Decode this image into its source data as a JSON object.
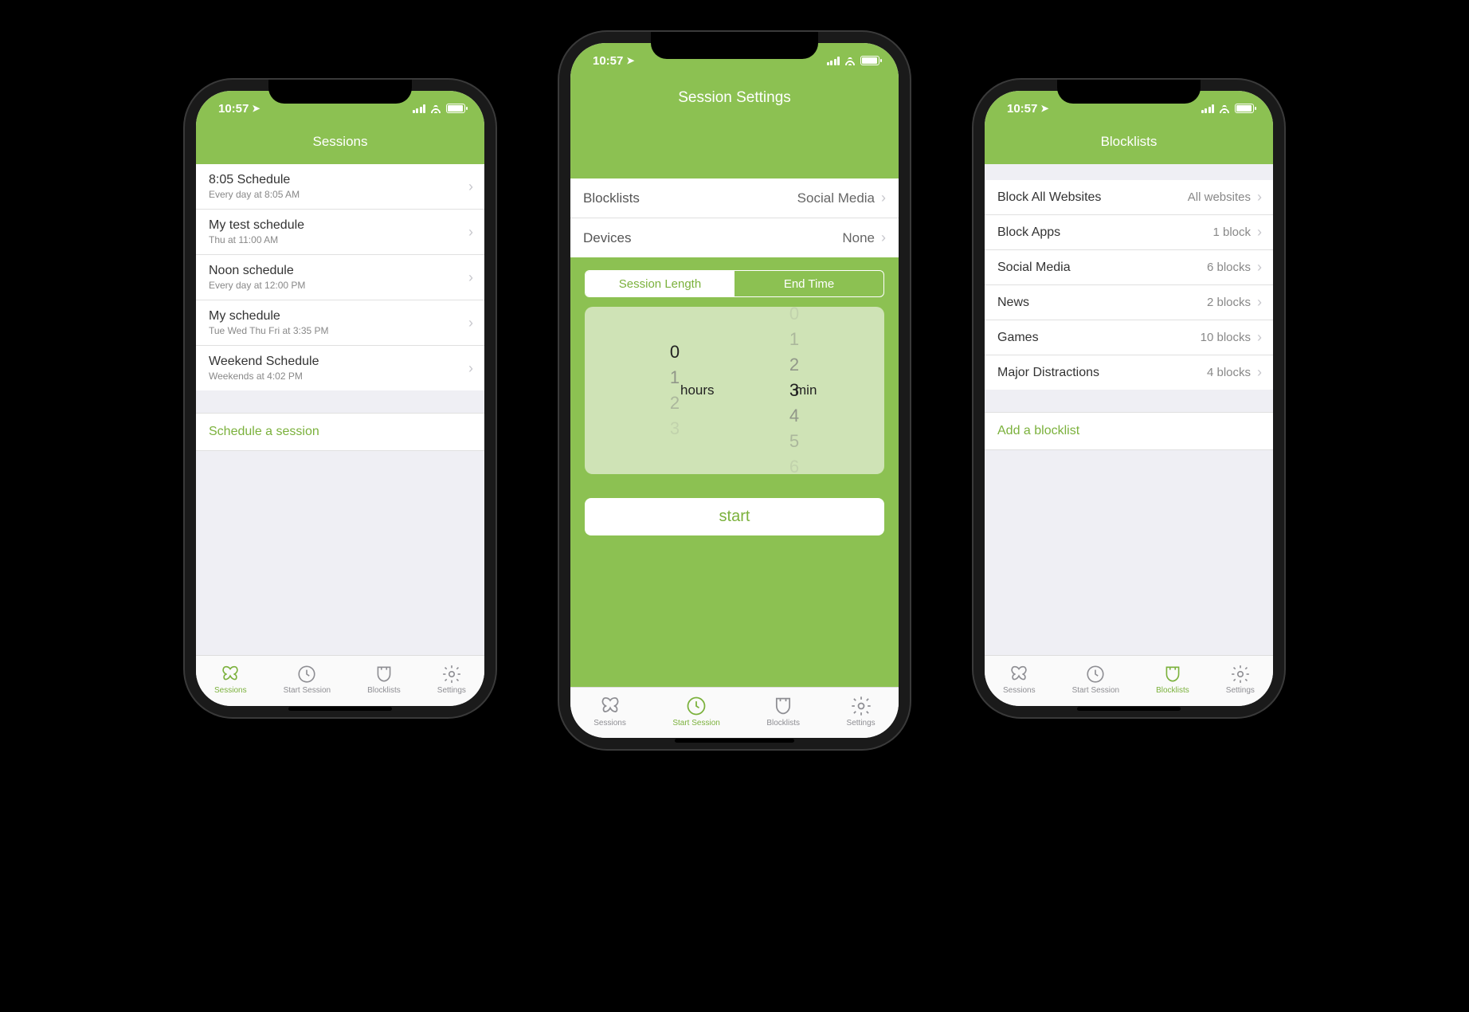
{
  "status": {
    "time": "10:57"
  },
  "tabs": {
    "sessions": "Sessions",
    "start": "Start Session",
    "blocklists": "Blocklists",
    "settings": "Settings"
  },
  "phone1": {
    "header": "Sessions",
    "items": [
      {
        "title": "8:05 Schedule",
        "sub": "Every day at 8:05 AM"
      },
      {
        "title": "My test schedule",
        "sub": "Thu at 11:00 AM"
      },
      {
        "title": "Noon schedule",
        "sub": "Every day at 12:00 PM"
      },
      {
        "title": "My schedule",
        "sub": "Tue Wed Thu Fri at 3:35 PM"
      },
      {
        "title": "Weekend Schedule",
        "sub": "Weekends at 4:02 PM"
      }
    ],
    "action": "Schedule a session"
  },
  "phone2": {
    "header": "Session Settings",
    "rows": [
      {
        "label": "Blocklists",
        "value": "Social Media"
      },
      {
        "label": "Devices",
        "value": "None"
      }
    ],
    "seg": {
      "a": "Session Length",
      "b": "End Time"
    },
    "picker": {
      "hours_label": "hours",
      "min_label": "min",
      "hours_sel": "0",
      "mins_sel": "3",
      "hours_after": [
        "1",
        "2",
        "3"
      ],
      "mins_before": [
        "0",
        "1",
        "2"
      ],
      "mins_after": [
        "4",
        "5",
        "6"
      ]
    },
    "start": "start"
  },
  "phone3": {
    "header": "Blocklists",
    "items": [
      {
        "title": "Block All Websites",
        "value": "All websites"
      },
      {
        "title": "Block Apps",
        "value": "1 block"
      },
      {
        "title": "Social Media",
        "value": "6 blocks"
      },
      {
        "title": "News",
        "value": "2 blocks"
      },
      {
        "title": "Games",
        "value": "10 blocks"
      },
      {
        "title": "Major Distractions",
        "value": "4 blocks"
      }
    ],
    "action": "Add a blocklist"
  }
}
